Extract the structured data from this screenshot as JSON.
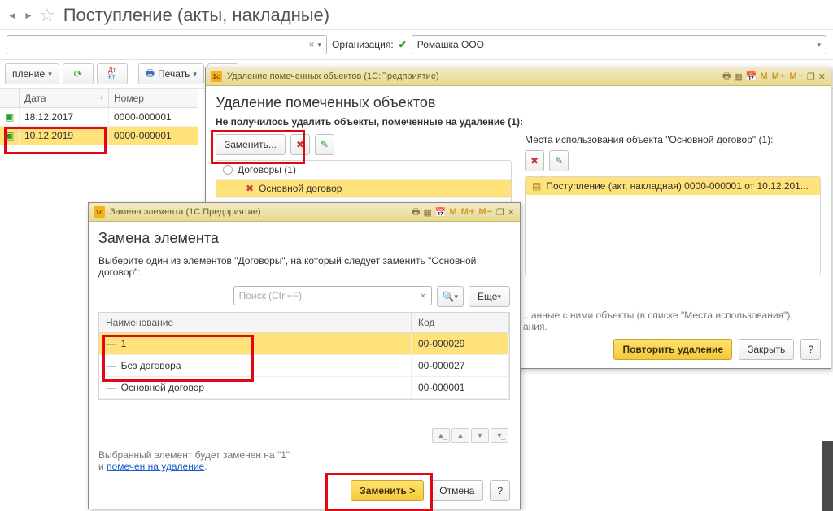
{
  "page": {
    "title": "Поступление (акты, накладные)",
    "org_label": "Организация:",
    "org_value": "Ромашка ООО"
  },
  "toolbar": {
    "tab_label": "пление",
    "print_label": "Печать"
  },
  "grid": {
    "col_date": "Дата",
    "col_num": "Номер",
    "rows": [
      {
        "date": "18.12.2017",
        "num": "0000-000001"
      },
      {
        "date": "10.12.2019",
        "num": "0000-000001"
      }
    ]
  },
  "del_win": {
    "title": "Удаление помеченных объектов  (1С:Предприятие)",
    "h1": "Удаление помеченных объектов",
    "fail_msg": "Не получилось удалить объекты, помеченные на удаление (1):",
    "replace_btn": "Заменить...",
    "tree_group": "Договоры (1)",
    "tree_item": "Основной договор",
    "usage_caption": "Места использования объекта \"Основной договор\" (1):",
    "usage_item": "Поступление (акт, накладная) 0000-000001 от 10.12.201...",
    "hint_tail": "...анные с ними объекты (в списке \"Места использования\"),",
    "hint_tail2": "ания.",
    "retry_btn": "Повторить удаление",
    "close_btn": "Закрыть",
    "help_btn": "?"
  },
  "repl_win": {
    "title": "Замена элемента  (1С:Предприятие)",
    "h1": "Замена элемента",
    "instr": "Выберите один из элементов \"Договоры\", на который следует заменить \"Основной договор\":",
    "search_ph": "Поиск (Ctrl+F)",
    "more_btn": "Еще",
    "col_name": "Наименование",
    "col_code": "Код",
    "rows": [
      {
        "name": "1",
        "code": "00-000029"
      },
      {
        "name": "Без договора",
        "code": "00-000027"
      },
      {
        "name": "Основной договор",
        "code": "00-000001"
      }
    ],
    "footer_text1": "Выбранный элемент будет заменен на \"1\"",
    "footer_text2": "и ",
    "footer_link": "помечен на удаление",
    "replace_btn": "Заменить >",
    "cancel_btn": "Отмена",
    "help_btn": "?"
  },
  "calc_labels": {
    "m": "M",
    "mp": "M+",
    "mm": "M−"
  }
}
